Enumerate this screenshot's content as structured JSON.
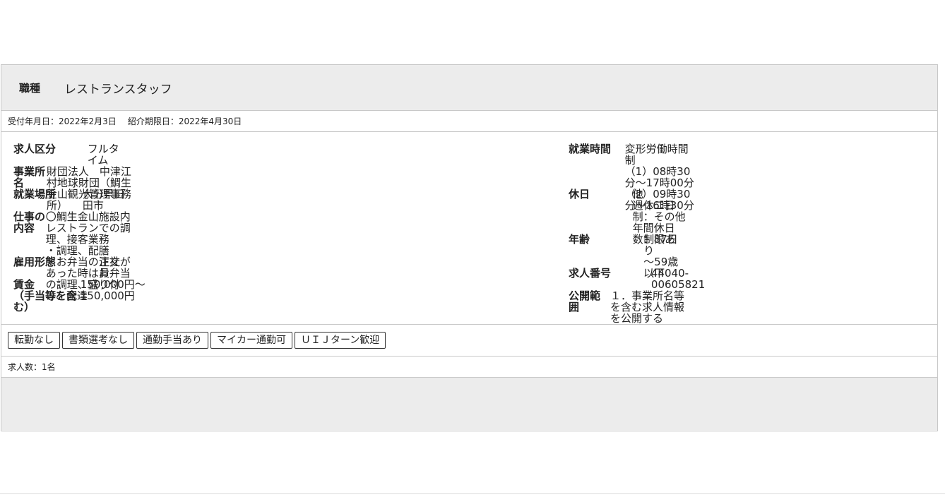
{
  "header": {
    "job_label": "職種",
    "job_value": "レストランスタッフ"
  },
  "dates": {
    "received": "受付年月日：2022年2月3日",
    "expiry": "紹介期限日：2022年4月30日"
  },
  "left": [
    {
      "label": "求人区分",
      "value": "フルタイム"
    },
    {
      "label": "事業所名",
      "value": "財団法人　中津江村地球財団（鯛生金山観光管理事務所）"
    },
    {
      "label": "就業場所",
      "value": "大分県日田市"
    },
    {
      "label": "仕事の内容",
      "value": "〇鯛生金山施設内レストランでの調理、接客業務\n・調理、配膳\n・お弁当の注文があった時はお弁当の調理、盛り付け、配達"
    },
    {
      "label": "雇用形態",
      "value": "正社員"
    },
    {
      "label": "賃金\n（手当等を含む）",
      "value": "150,000円〜150,000円"
    }
  ],
  "right": [
    {
      "label": "就業時間",
      "value": "変形労働時間制\n（1）08時30分〜17時00分\n（2）09時30分〜16時30分"
    },
    {
      "label": "休日",
      "value": "他\n週休二日制：その他\n年間休日数：87日"
    },
    {
      "label": "年齢",
      "value": "制限あり\n〜59歳以下"
    },
    {
      "label": "求人番号",
      "value": "44040-00605821"
    },
    {
      "label": "公開範囲",
      "value": "１．事業所名等を含む求人情報を公開する"
    }
  ],
  "tags": [
    "転勤なし",
    "書類選考なし",
    "通勤手当あり",
    "マイカー通勤可",
    "ＵＩＪターン歓迎"
  ],
  "count": "求人数：1名"
}
